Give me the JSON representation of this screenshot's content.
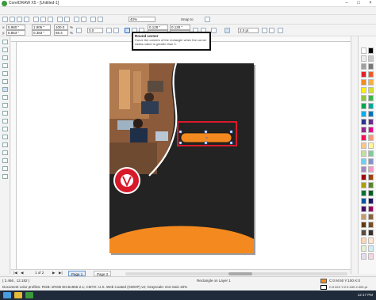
{
  "app": {
    "title": "CorelDRAW X5 - [Untitled-1]",
    "window_controls": [
      "–",
      "□",
      "×"
    ]
  },
  "toolbar": {
    "zoom_value": "40%",
    "snap_to": "Snap to",
    "x_value": "5.980 \"",
    "y_value": "5.853 \"",
    "w_value": "1.905 \"",
    "h_value": "0.383 \"",
    "scale_w": "100.0",
    "scale_h": "66.4",
    "percent": "%",
    "angle_value": "0.0",
    "corner_tl": "0.128 \"",
    "corner_bl": "0.128 \"",
    "corner_tr": "0.128 \"",
    "corner_br": "0.128 \"",
    "outline_width": "2.0 pt"
  },
  "tooltip": {
    "title": "Round corner",
    "body": "Curve the corners of the rectangle when the corner radius value is greater than 0."
  },
  "pagenav": {
    "counter": "1 of 2",
    "tabs": [
      "Page 1",
      "Page 2"
    ]
  },
  "status": {
    "coords": "( 2.466 , 12.182 )",
    "selection": "Rectangle on Layer 1",
    "color_profiles": "Document color profiles: RGB: sRGB IEC61966-2.1; CMYK: U.S. Web Coated (SWOP) v2; Grayscale: Dot Gain 20%",
    "fill_info": "C:0 M:60 Y:100 K:0",
    "outline_info": "C:0 M:0 Y:0 K:100  2.000 pt"
  },
  "taskbar": {
    "clock": "12:17 PM"
  },
  "colors": {
    "page_bg": "#232323",
    "orange": "#f48a1f",
    "red_frame": "#d8192a",
    "selection_blue": "#2a5bd7"
  },
  "palette": [
    "#ffffff",
    "#000000",
    "#ececec",
    "#c8c8c8",
    "#a0a0a0",
    "#787878",
    "#e41e26",
    "#f05a22",
    "#f48a1f",
    "#fbb03b",
    "#fff200",
    "#d7df23",
    "#8dc63f",
    "#39b54a",
    "#00a651",
    "#00a99d",
    "#00aeef",
    "#0072bc",
    "#2e3192",
    "#662d91",
    "#92278f",
    "#ec008c",
    "#ed145b",
    "#f7977a",
    "#fdc689",
    "#fff799",
    "#c4df9b",
    "#82ca9c",
    "#6dcff6",
    "#8393ca",
    "#a187be",
    "#f49ac1",
    "#9e0b0f",
    "#a0410d",
    "#aba000",
    "#598527",
    "#007236",
    "#005e20",
    "#0054a6",
    "#1b1464",
    "#440e62",
    "#9e005d",
    "#c69c6d",
    "#8c6239",
    "#603913",
    "#754c24",
    "#594a42",
    "#362f2d",
    "#ffd5b3",
    "#ffe6cc",
    "#e0f0d0",
    "#d0ebf5",
    "#e6dcf0",
    "#f5d5e6"
  ]
}
